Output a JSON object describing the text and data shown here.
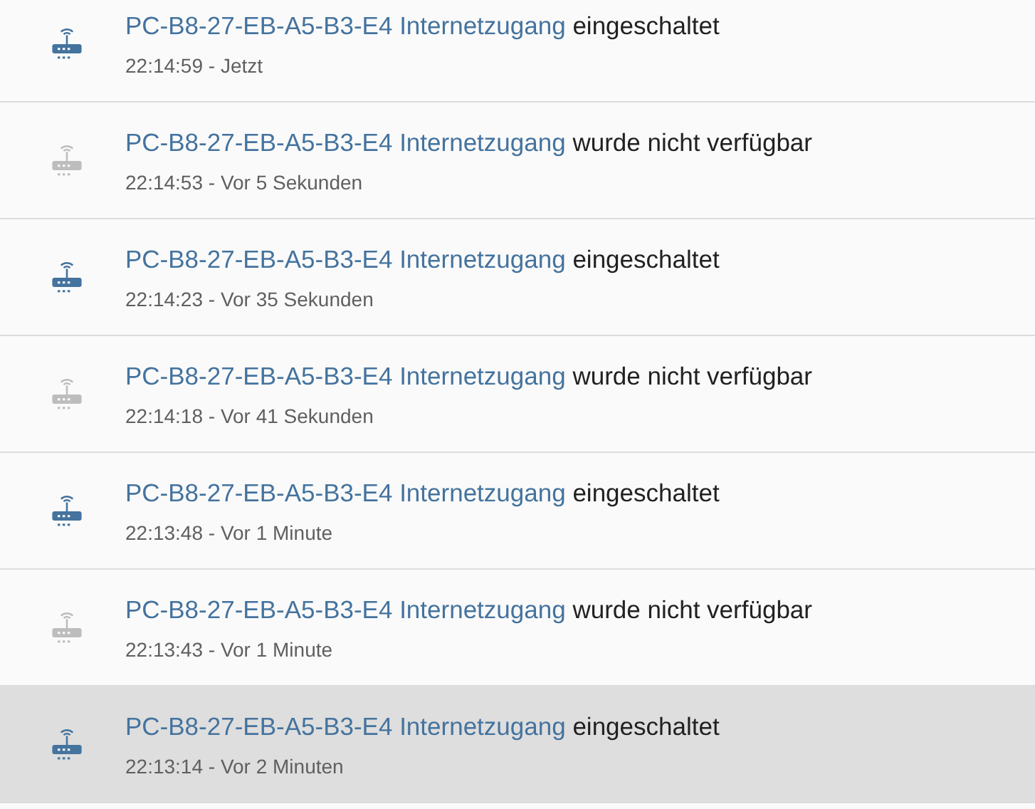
{
  "entries": [
    {
      "entity": "PC-B8-27-EB-A5-B3-E4 Internetzugang",
      "message": "eingeschaltet",
      "time": "22:14:59 - Jetzt",
      "available": true,
      "highlighted": false
    },
    {
      "entity": "PC-B8-27-EB-A5-B3-E4 Internetzugang",
      "message": "wurde nicht verfügbar",
      "time": "22:14:53 - Vor 5 Sekunden",
      "available": false,
      "highlighted": false
    },
    {
      "entity": "PC-B8-27-EB-A5-B3-E4 Internetzugang",
      "message": "eingeschaltet",
      "time": "22:14:23 - Vor 35 Sekunden",
      "available": true,
      "highlighted": false
    },
    {
      "entity": "PC-B8-27-EB-A5-B3-E4 Internetzugang",
      "message": "wurde nicht verfügbar",
      "time": "22:14:18 - Vor 41 Sekunden",
      "available": false,
      "highlighted": false
    },
    {
      "entity": "PC-B8-27-EB-A5-B3-E4 Internetzugang",
      "message": "eingeschaltet",
      "time": "22:13:48 - Vor 1 Minute",
      "available": true,
      "highlighted": false
    },
    {
      "entity": "PC-B8-27-EB-A5-B3-E4 Internetzugang",
      "message": "wurde nicht verfügbar",
      "time": "22:13:43 - Vor 1 Minute",
      "available": false,
      "highlighted": false
    },
    {
      "entity": "PC-B8-27-EB-A5-B3-E4 Internetzugang",
      "message": "eingeschaltet",
      "time": "22:13:14 - Vor 2 Minuten",
      "available": true,
      "highlighted": true
    }
  ]
}
